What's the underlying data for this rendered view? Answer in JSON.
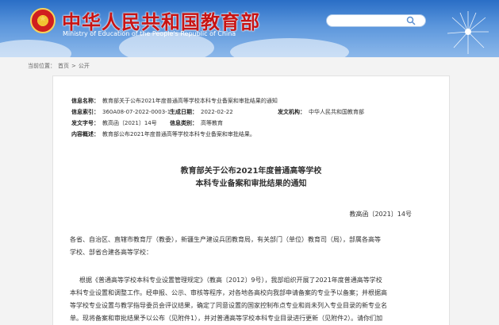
{
  "header": {
    "title": "中华人民共和国教育部",
    "subtitle": "Ministry of Education of the People's Republic of China",
    "search_placeholder": ""
  },
  "breadcrumb": {
    "label": "当前位置：",
    "home": "首页",
    "separator": ">",
    "section": "公开"
  },
  "meta": {
    "name_label": "信息名称：",
    "name_value": "教育部关于公布2021年度普通高等学校本科专业备案和审批结果的通知",
    "index_label": "信息索引：",
    "index_value": "360A08-07-2022-0003-1",
    "date_label": "生成日期：",
    "date_value": "2022-02-22",
    "issuer_label": "发文机构：",
    "issuer_value": "中华人民共和国教育部",
    "doc_no_label": "发文字号：",
    "doc_no_value": "教高函〔2021〕14号",
    "category_label": "信息类别：",
    "category_value": "高等教育",
    "summary_label": "内容概述：",
    "summary_value": "教育部公布2021年度普通高等学校本科专业备案和审批结果。"
  },
  "document": {
    "title_line1": "教育部关于公布2021年度普通高等学校",
    "title_line2": "本科专业备案和审批结果的通知",
    "doc_number": "教高函〔2021〕14号",
    "salutation_line1": "各省、自治区、直辖市教育厅（教委），新疆生产建设兵团教育局，有关部门（单位）教育司（局），部属各高等",
    "salutation_line2": "学校、部省合建各高等学校：",
    "body_line1": "根据《普通高等学校本科专业设置管理规定》（教高〔2012〕9号），我部组织开展了2021年度普通高等学校",
    "body_line2": "本科专业设置和调整工作。经申报、公示、审核等程序，对各地各高校向我部申请备案的专业予以备案；并根据高",
    "body_line3": "等学校专业设置与教学指导委员会评议结果，确定了同意设置的国家控制布点专业和尚未列入专业目录的新专业名",
    "body_line4": "单。现将备案和审批结果予以公布（见附件1），并对普通高等学校本科专业目录进行更新（见附件2）。请你们加"
  },
  "colors": {
    "header_blue": "#2a6ec6",
    "title_red": "#c81414"
  }
}
